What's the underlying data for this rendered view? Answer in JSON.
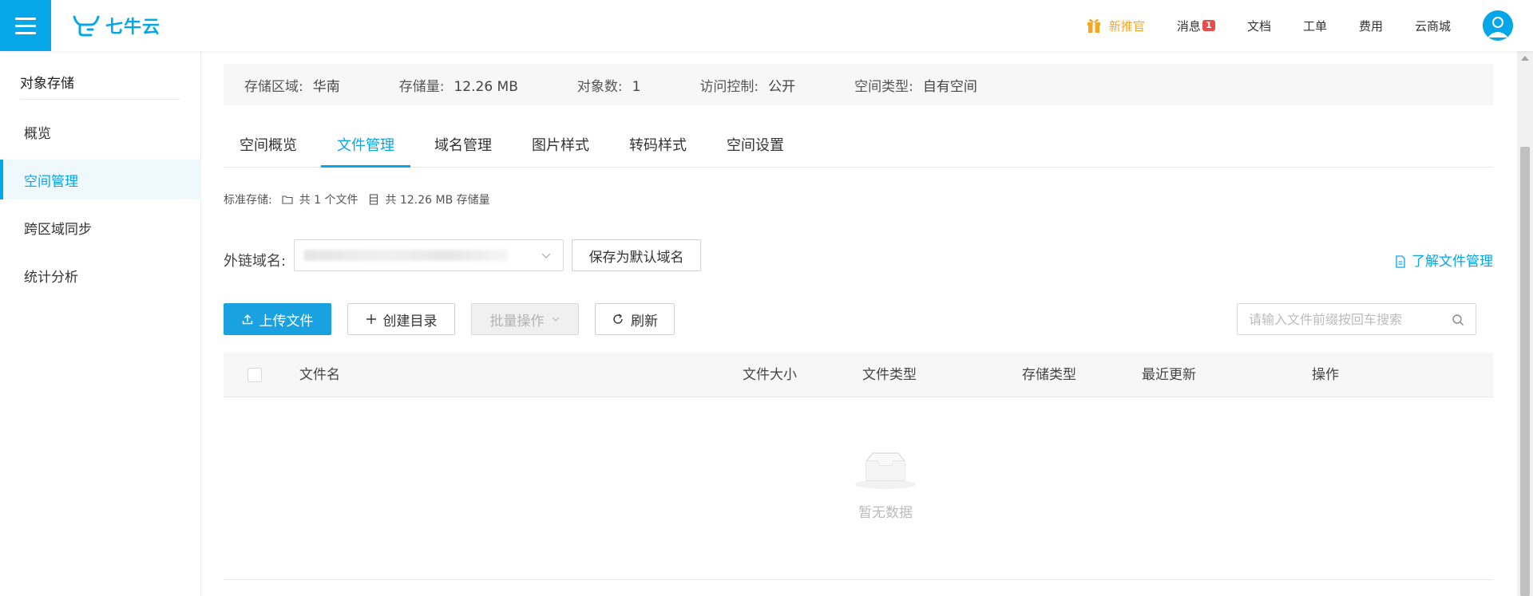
{
  "header": {
    "logo_text": "七牛云",
    "nav": {
      "promo": "新推官",
      "messages": "消息",
      "messages_count": "1",
      "docs": "文档",
      "tickets": "工单",
      "billing": "费用",
      "market": "云商城"
    }
  },
  "sidebar": {
    "title": "对象存储",
    "items": [
      {
        "label": "概览"
      },
      {
        "label": "空间管理"
      },
      {
        "label": "跨区域同步"
      },
      {
        "label": "统计分析"
      }
    ]
  },
  "infobar": {
    "region_label": "存储区域:",
    "region_value": "华南",
    "storage_label": "存储量:",
    "storage_value": "12.26 MB",
    "objects_label": "对象数:",
    "objects_value": "1",
    "access_label": "访问控制:",
    "access_value": "公开",
    "type_label": "空间类型:",
    "type_value": "自有空间"
  },
  "tabs": [
    {
      "label": "空间概览"
    },
    {
      "label": "文件管理"
    },
    {
      "label": "域名管理"
    },
    {
      "label": "图片样式"
    },
    {
      "label": "转码样式"
    },
    {
      "label": "空间设置"
    }
  ],
  "storage_summary": {
    "label": "标准存储:",
    "files": "共 1 个文件",
    "size": "共 12.26 MB 存储量"
  },
  "domain": {
    "label": "外链域名:",
    "save_default": "保存为默认域名",
    "learn_link": "了解文件管理"
  },
  "toolbar": {
    "upload": "上传文件",
    "create_dir": "创建目录",
    "batch": "批量操作",
    "refresh": "刷新",
    "search_placeholder": "请输入文件前缀按回车搜索"
  },
  "table": {
    "columns": [
      "文件名",
      "文件大小",
      "文件类型",
      "存储类型",
      "最近更新",
      "操作"
    ],
    "empty_text": "暂无数据"
  },
  "colors": {
    "accent": "#06a7e8",
    "promo": "#f5a623",
    "badge": "#e84c4c"
  }
}
